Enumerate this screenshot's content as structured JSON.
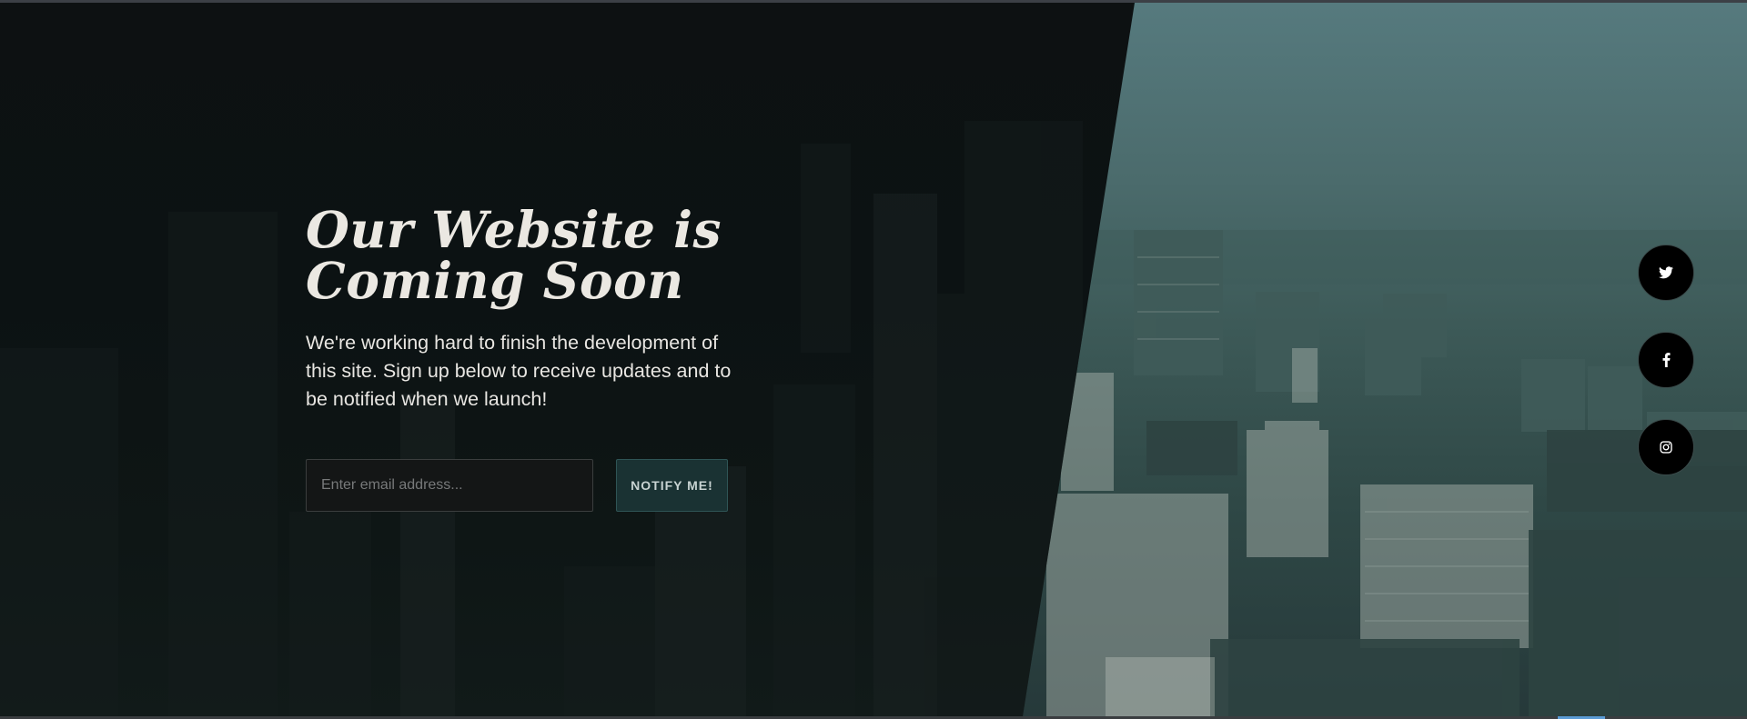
{
  "hero": {
    "title_line1": "Our Website is",
    "title_line2": "Coming Soon",
    "subtitle": "We're working hard to finish the development of this site. Sign up below to receive updates and to be notified when we launch!"
  },
  "form": {
    "email_placeholder": "Enter email address...",
    "email_value": "",
    "submit_label": "NOTIFY ME!"
  },
  "social": [
    {
      "name": "twitter",
      "icon": "twitter-icon"
    },
    {
      "name": "facebook",
      "icon": "facebook-icon"
    },
    {
      "name": "instagram",
      "icon": "instagram-icon"
    }
  ],
  "colors": {
    "overlay": "#0d1112",
    "accent_button": "#1a3233",
    "title_text": "#ebe8e2",
    "sky": "#567a7e"
  }
}
